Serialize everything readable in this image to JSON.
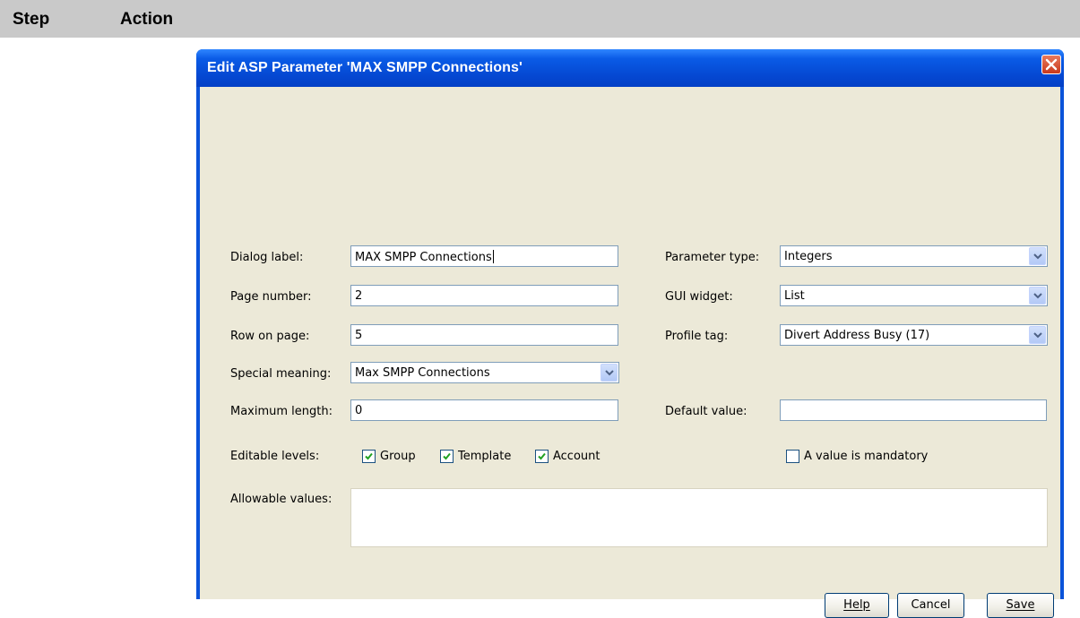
{
  "table": {
    "col_step": "Step",
    "col_action": "Action"
  },
  "dialog": {
    "title": "Edit ASP Parameter 'MAX SMPP Connections'",
    "close_icon": "close-icon",
    "fields": {
      "dialog_label": {
        "label": "Dialog label:",
        "value": "MAX SMPP Connections"
      },
      "page_number": {
        "label": "Page number:",
        "value": "2"
      },
      "row_on_page": {
        "label": "Row on page:",
        "value": "5"
      },
      "special_meaning": {
        "label": "Special meaning:",
        "value": "Max SMPP Connections"
      },
      "maximum_length": {
        "label": "Maximum length:",
        "value": "0"
      },
      "parameter_type": {
        "label": "Parameter type:",
        "value": "Integers"
      },
      "gui_widget": {
        "label": "GUI widget:",
        "value": "List"
      },
      "profile_tag": {
        "label": "Profile tag:",
        "value": "Divert Address Busy (17)"
      },
      "default_value": {
        "label": "Default value:",
        "value": ""
      }
    },
    "editable_levels": {
      "label": "Editable levels:",
      "options": [
        {
          "label": "Group",
          "checked": true
        },
        {
          "label": "Template",
          "checked": true
        },
        {
          "label": "Account",
          "checked": true
        }
      ]
    },
    "mandatory": {
      "label": "A value is mandatory",
      "checked": false
    },
    "allowable_values": {
      "label": "Allowable values:"
    },
    "buttons": {
      "help": "Help",
      "cancel": "Cancel",
      "save": "Save"
    }
  }
}
